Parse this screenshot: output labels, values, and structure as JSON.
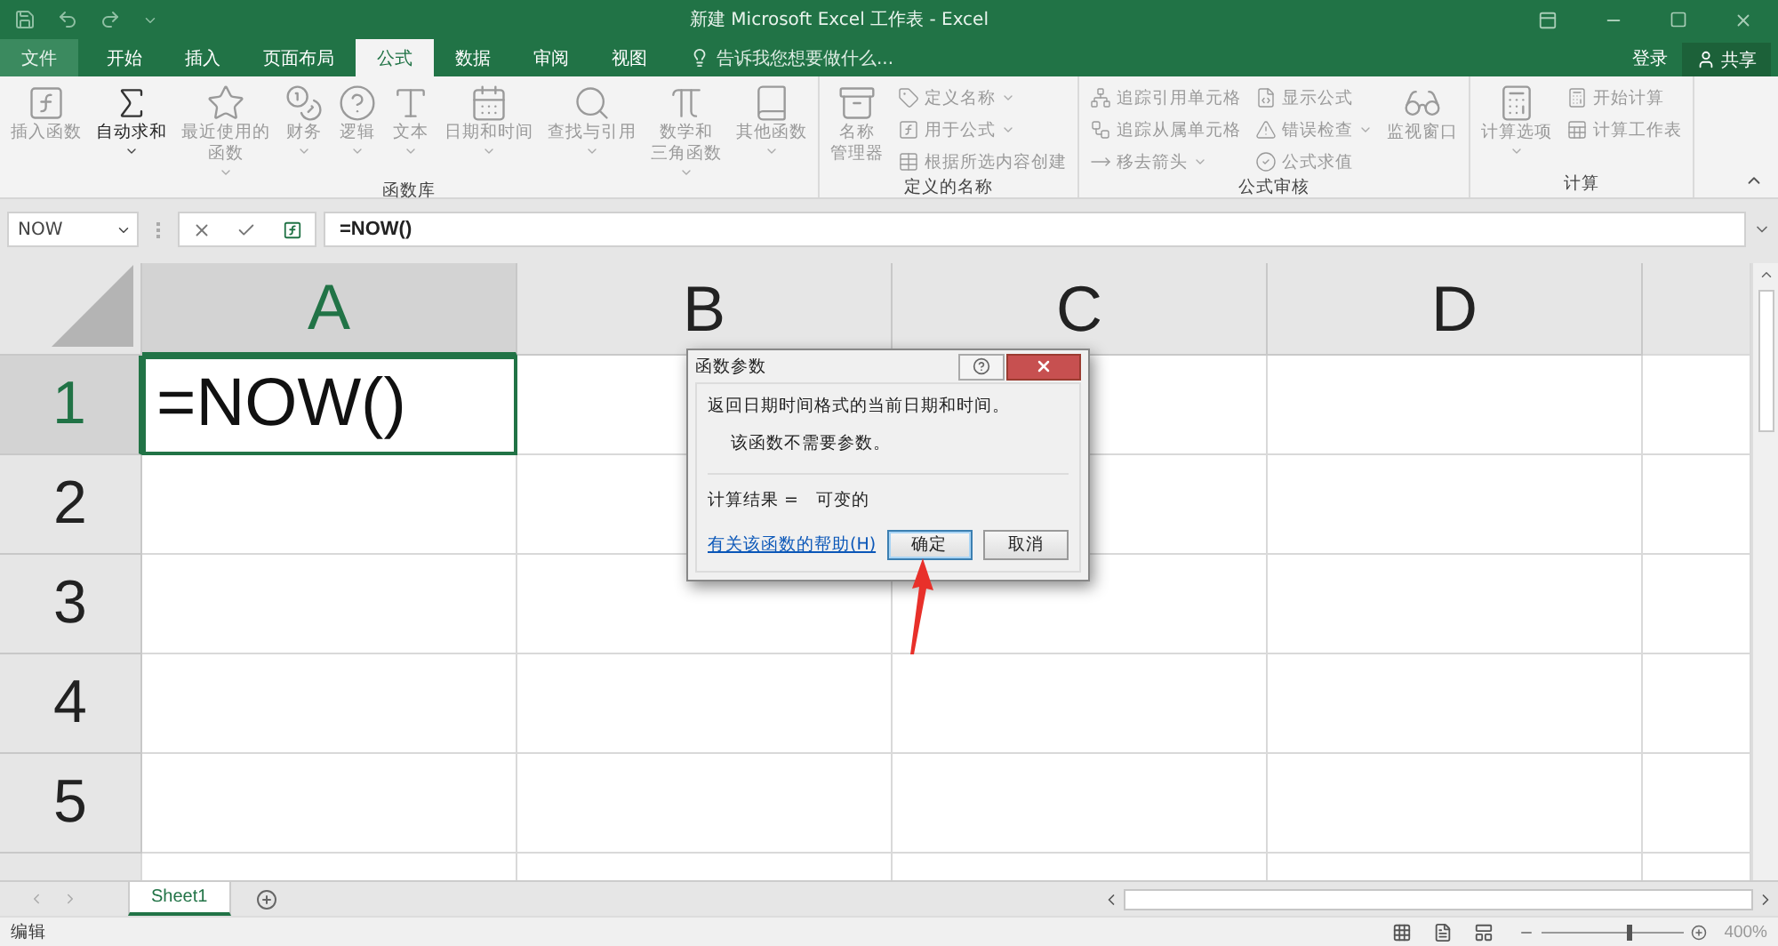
{
  "title_bar": {
    "title": "新建 Microsoft Excel 工作表 - Excel"
  },
  "menu_tabs": [
    {
      "label": "文件",
      "selected": false,
      "kind": "file"
    },
    {
      "label": "开始",
      "selected": false,
      "kind": "tab"
    },
    {
      "label": "插入",
      "selected": false,
      "kind": "tab"
    },
    {
      "label": "页面布局",
      "selected": false,
      "kind": "tab"
    },
    {
      "label": "公式",
      "selected": true,
      "kind": "tab"
    },
    {
      "label": "数据",
      "selected": false,
      "kind": "tab"
    },
    {
      "label": "审阅",
      "selected": false,
      "kind": "tab"
    },
    {
      "label": "视图",
      "selected": false,
      "kind": "tab"
    }
  ],
  "tell_me": {
    "placeholder": "告诉我您想要做什么..."
  },
  "sign_in": "登录",
  "share": "共享",
  "ribbon": [
    {
      "label": "函数库",
      "columns": [
        {
          "kind": "large",
          "items": [
            {
              "lines": [
                "插入函数"
              ],
              "disabled": true,
              "dropdown": false
            }
          ]
        },
        {
          "kind": "large",
          "items": [
            {
              "lines": [
                "自动求和"
              ],
              "disabled": false,
              "dropdown": true
            }
          ]
        },
        {
          "kind": "large",
          "items": [
            {
              "lines": [
                "最近使用的",
                "函数"
              ],
              "disabled": true,
              "dropdown": true
            }
          ]
        },
        {
          "kind": "large",
          "items": [
            {
              "lines": [
                "财务"
              ],
              "disabled": true,
              "dropdown": true
            }
          ]
        },
        {
          "kind": "large",
          "items": [
            {
              "lines": [
                "逻辑"
              ],
              "disabled": true,
              "dropdown": true
            }
          ]
        },
        {
          "kind": "large",
          "items": [
            {
              "lines": [
                "文本"
              ],
              "disabled": true,
              "dropdown": true
            }
          ]
        },
        {
          "kind": "large",
          "items": [
            {
              "lines": [
                "日期和时间"
              ],
              "disabled": true,
              "dropdown": true
            }
          ]
        },
        {
          "kind": "large",
          "items": [
            {
              "lines": [
                "查找与引用"
              ],
              "disabled": true,
              "dropdown": true
            }
          ]
        },
        {
          "kind": "large",
          "items": [
            {
              "lines": [
                "数学和",
                "三角函数"
              ],
              "disabled": true,
              "dropdown": true
            }
          ]
        },
        {
          "kind": "large",
          "items": [
            {
              "lines": [
                "其他函数"
              ],
              "disabled": true,
              "dropdown": true
            }
          ]
        }
      ]
    },
    {
      "label": "定义的名称",
      "columns": [
        {
          "kind": "large",
          "items": [
            {
              "lines": [
                "名称",
                "管理器"
              ],
              "disabled": true,
              "dropdown": false
            }
          ]
        },
        {
          "kind": "stack",
          "items": [
            {
              "lines": [
                "定义名称"
              ],
              "disabled": true,
              "dropdown": true
            },
            {
              "lines": [
                "用于公式"
              ],
              "disabled": true,
              "dropdown": true
            },
            {
              "lines": [
                "根据所选内容创建"
              ],
              "disabled": true,
              "dropdown": false
            }
          ]
        }
      ]
    },
    {
      "label": "公式审核",
      "columns": [
        {
          "kind": "stack",
          "items": [
            {
              "lines": [
                "追踪引用单元格"
              ],
              "disabled": true,
              "dropdown": false
            },
            {
              "lines": [
                "追踪从属单元格"
              ],
              "disabled": true,
              "dropdown": false
            },
            {
              "lines": [
                "移去箭头"
              ],
              "disabled": true,
              "dropdown": true
            }
          ]
        },
        {
          "kind": "stack",
          "items": [
            {
              "lines": [
                "显示公式"
              ],
              "disabled": true,
              "dropdown": false
            },
            {
              "lines": [
                "错误检查"
              ],
              "disabled": true,
              "dropdown": true
            },
            {
              "lines": [
                "公式求值"
              ],
              "disabled": true,
              "dropdown": false
            }
          ]
        },
        {
          "kind": "large",
          "items": [
            {
              "lines": [
                "监视窗口"
              ],
              "disabled": true,
              "dropdown": false
            }
          ]
        }
      ]
    },
    {
      "label": "计算",
      "columns": [
        {
          "kind": "large",
          "items": [
            {
              "lines": [
                "计算选项"
              ],
              "disabled": true,
              "dropdown": true
            }
          ]
        },
        {
          "kind": "stack",
          "items": [
            {
              "lines": [
                "开始计算"
              ],
              "disabled": true,
              "dropdown": false
            },
            {
              "lines": [
                "计算工作表"
              ],
              "disabled": true,
              "dropdown": false
            }
          ]
        }
      ]
    }
  ],
  "formula_bar": {
    "name_box": "NOW",
    "formula": "=NOW()"
  },
  "grid": {
    "columns": [
      {
        "label": "A",
        "selected": true
      },
      {
        "label": "B",
        "selected": false
      },
      {
        "label": "C",
        "selected": false
      },
      {
        "label": "D",
        "selected": false
      }
    ],
    "rows": [
      {
        "label": "1",
        "selected": true,
        "cells": [
          "=NOW()",
          "",
          "",
          ""
        ]
      },
      {
        "label": "2",
        "selected": false,
        "cells": [
          "",
          "",
          "",
          ""
        ]
      },
      {
        "label": "3",
        "selected": false,
        "cells": [
          "",
          "",
          "",
          ""
        ]
      },
      {
        "label": "4",
        "selected": false,
        "cells": [
          "",
          "",
          "",
          ""
        ]
      },
      {
        "label": "5",
        "selected": false,
        "cells": [
          "",
          "",
          "",
          ""
        ]
      }
    ]
  },
  "dialog": {
    "title": "函数参数",
    "description": "返回日期时间格式的当前日期和时间。",
    "note": "该函数不需要参数。",
    "result_label": "计算结果 =",
    "result_value": "可变的",
    "help_link": "有关该函数的帮助(H)",
    "buttons": [
      {
        "label": "确定",
        "default": true
      },
      {
        "label": "取消",
        "default": false
      }
    ]
  },
  "sheet_tabs": [
    {
      "label": "Sheet1",
      "selected": true
    }
  ],
  "status_bar": {
    "mode": "编辑",
    "zoom": "400%",
    "zoom_slider": {
      "level": 0.6
    }
  }
}
